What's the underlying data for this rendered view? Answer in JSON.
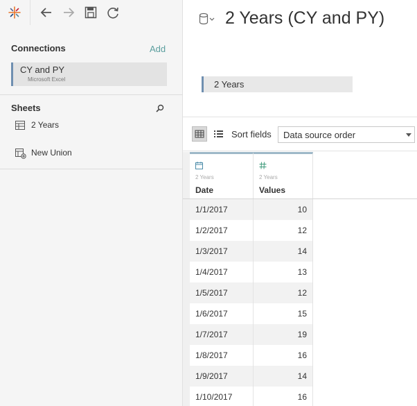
{
  "toolbar": {
    "logo_icon": "tableau-logo-icon",
    "back_icon": "arrow-left-icon",
    "forward_icon": "arrow-right-icon",
    "save_icon": "save-icon",
    "refresh_icon": "refresh-icon"
  },
  "connections": {
    "title": "Connections",
    "add_label": "Add",
    "items": [
      {
        "name": "CY and PY",
        "type": "Microsoft Excel"
      }
    ]
  },
  "sheets": {
    "title": "Sheets",
    "items": [
      {
        "label": "2 Years",
        "icon": "table-icon"
      },
      {
        "label": "New Union",
        "icon": "union-icon"
      }
    ]
  },
  "datasource": {
    "title": "2 Years (CY and PY)",
    "icon": "database-icon"
  },
  "canvas": {
    "table_name": "2 Years"
  },
  "grid_toolbar": {
    "sort_label": "Sort fields",
    "sort_value": "Data source order"
  },
  "columns": [
    {
      "source": "2 Years",
      "name": "Date",
      "type_icon": "calendar-icon"
    },
    {
      "source": "2 Years",
      "name": "Values",
      "type_icon": "number-icon"
    }
  ],
  "rows": [
    {
      "date": "1/1/2017",
      "value": "10"
    },
    {
      "date": "1/2/2017",
      "value": "12"
    },
    {
      "date": "1/3/2017",
      "value": "14"
    },
    {
      "date": "1/4/2017",
      "value": "13"
    },
    {
      "date": "1/5/2017",
      "value": "12"
    },
    {
      "date": "1/6/2017",
      "value": "15"
    },
    {
      "date": "1/7/2017",
      "value": "19"
    },
    {
      "date": "1/8/2017",
      "value": "16"
    },
    {
      "date": "1/9/2017",
      "value": "14"
    },
    {
      "date": "1/10/2017",
      "value": "16"
    }
  ],
  "colors": {
    "accent_blue": "#6f8fb0",
    "add_link": "#5b9e9e",
    "header_top": "#9eb8c8"
  }
}
